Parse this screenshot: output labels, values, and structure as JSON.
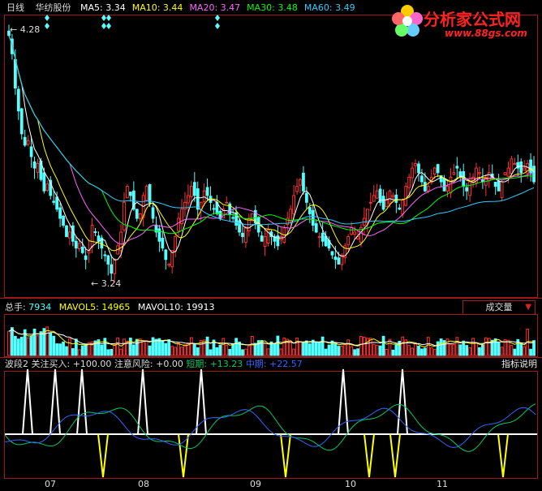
{
  "header": {
    "period": "日线",
    "stock": "华纺股份",
    "ma": [
      {
        "label": "MA5:",
        "value": "3.34",
        "color": "#ffffff"
      },
      {
        "label": "MA10:",
        "value": "3.44",
        "color": "#ffff00"
      },
      {
        "label": "MA20:",
        "value": "3.47",
        "color": "#ff66ff"
      },
      {
        "label": "MA30:",
        "value": "3.48",
        "color": "#00ff00"
      },
      {
        "label": "MA60:",
        "value": "3.49",
        "color": "#33ccff"
      }
    ]
  },
  "annotations": {
    "high": "4.28",
    "low": "3.24"
  },
  "logo": {
    "title": "分析家公式网",
    "url": "www.88gs.com"
  },
  "volume_panel": {
    "label": "总手:",
    "value": "7934",
    "mavol5_label": "MAVOL5:",
    "mavol5": "14965",
    "mavol10_label": "MAVOL10:",
    "mavol10": "19913",
    "selector": "成交量"
  },
  "indicator_panel": {
    "name": "波段2",
    "buy_label": "关注买入:",
    "buy_value": "+100.00",
    "risk_label": "注意风险:",
    "risk_value": "+0.00",
    "short_label": "短期:",
    "short_value": "+13.23",
    "mid_label": "中期:",
    "mid_value": "+22.57",
    "help": "指标说明"
  },
  "months": [
    "07",
    "08",
    "09",
    "10",
    "11"
  ],
  "colors": {
    "up": "#ff3030",
    "down": "#54ffff",
    "frame": "#a01818"
  },
  "chart_data": {
    "type": "candlestick",
    "price_range": [
      3.15,
      4.35
    ],
    "closes": [
      4.28,
      4.2,
      4.05,
      3.95,
      3.85,
      3.8,
      3.82,
      3.75,
      3.7,
      3.72,
      3.65,
      3.6,
      3.63,
      3.58,
      3.55,
      3.52,
      3.48,
      3.45,
      3.4,
      3.42,
      3.38,
      3.35,
      3.37,
      3.33,
      3.3,
      3.34,
      3.45,
      3.42,
      3.38,
      3.35,
      3.32,
      3.28,
      3.24,
      3.3,
      3.36,
      3.42,
      3.55,
      3.62,
      3.58,
      3.52,
      3.48,
      3.5,
      3.58,
      3.62,
      3.55,
      3.48,
      3.42,
      3.38,
      3.35,
      3.3,
      3.28,
      3.34,
      3.4,
      3.48,
      3.52,
      3.55,
      3.58,
      3.62,
      3.58,
      3.52,
      3.55,
      3.6,
      3.58,
      3.55,
      3.52,
      3.5,
      3.48,
      3.52,
      3.55,
      3.5,
      3.48,
      3.45,
      3.42,
      3.4,
      3.44,
      3.48,
      3.5,
      3.46,
      3.42,
      3.38,
      3.4,
      3.43,
      3.4,
      3.38,
      3.36,
      3.4,
      3.44,
      3.48,
      3.52,
      3.58,
      3.62,
      3.65,
      3.6,
      3.55,
      3.5,
      3.45,
      3.42,
      3.4,
      3.38,
      3.36,
      3.35,
      3.32,
      3.3,
      3.28,
      3.32,
      3.36,
      3.4,
      3.44,
      3.42,
      3.4,
      3.44,
      3.48,
      3.52,
      3.55,
      3.58,
      3.6,
      3.55,
      3.52,
      3.56,
      3.6,
      3.58,
      3.55,
      3.52,
      3.56,
      3.62,
      3.66,
      3.7,
      3.72,
      3.68,
      3.64,
      3.6,
      3.62,
      3.66,
      3.7,
      3.68,
      3.64,
      3.6,
      3.62,
      3.66,
      3.68,
      3.7,
      3.66,
      3.62,
      3.6,
      3.64,
      3.66,
      3.7,
      3.68,
      3.64,
      3.66,
      3.68,
      3.66,
      3.62,
      3.6,
      3.64,
      3.68,
      3.7,
      3.74,
      3.72,
      3.7,
      3.68,
      3.7,
      3.72,
      3.68,
      3.64
    ],
    "volume_range": [
      0,
      60000
    ],
    "buy_signals_x": [
      34,
      68,
      101,
      176,
      248,
      423,
      496
    ],
    "risk_signals_x": [
      127,
      226,
      352,
      455,
      487,
      620
    ]
  }
}
